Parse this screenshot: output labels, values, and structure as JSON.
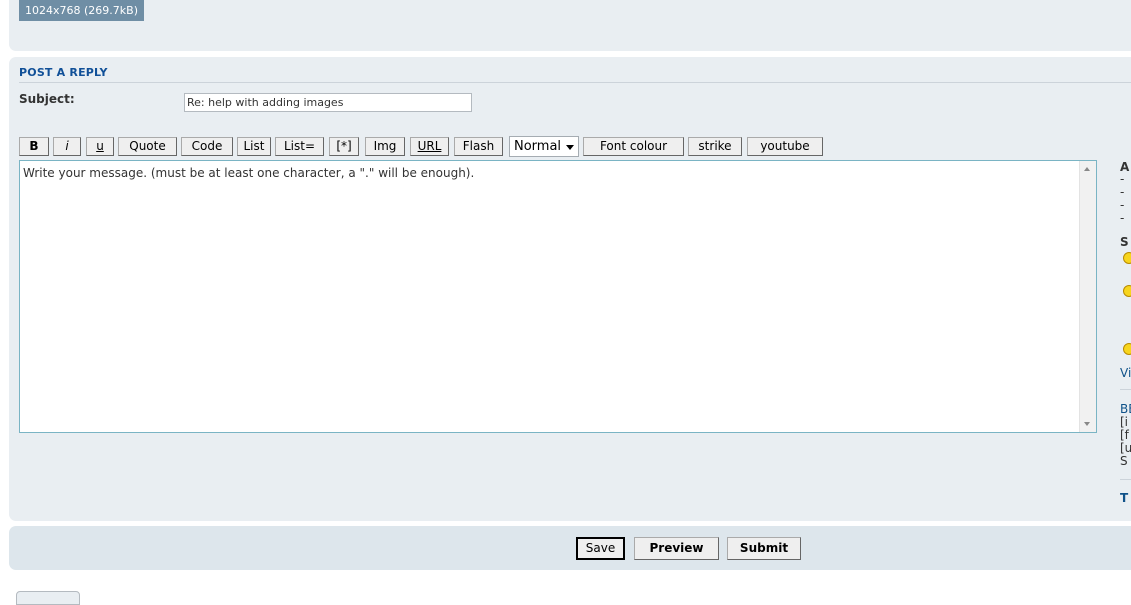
{
  "attachment": {
    "info": "1024x768 (269.7kB)"
  },
  "reply": {
    "title": "POST A REPLY",
    "subject_label": "Subject:",
    "subject_value": "Re: help with adding images"
  },
  "toolbar": {
    "bold": "B",
    "italic": "i",
    "underline": "u",
    "quote": "Quote",
    "code": "Code",
    "list": "List",
    "list_eq": "List=",
    "list_item": "[*]",
    "img": "Img",
    "url": "URL",
    "flash": "Flash",
    "font_size": "Normal",
    "font_colour": "Font colour",
    "strike": "strike",
    "youtube": "youtube"
  },
  "message": {
    "placeholder": "Write your message. (must be at least one character, a \".\" will be enough)."
  },
  "sidebar": {
    "a_heading": "A",
    "dashes": [
      "- ",
      "- ",
      "- ",
      "- "
    ],
    "s_heading": "S",
    "view_link": "Vi",
    "bb_link": "BB",
    "codes": [
      "[i",
      "[f",
      "[u",
      "S"
    ],
    "t_heading": "T"
  },
  "actions": {
    "save": "Save",
    "preview": "Preview",
    "submit": "Submit"
  }
}
